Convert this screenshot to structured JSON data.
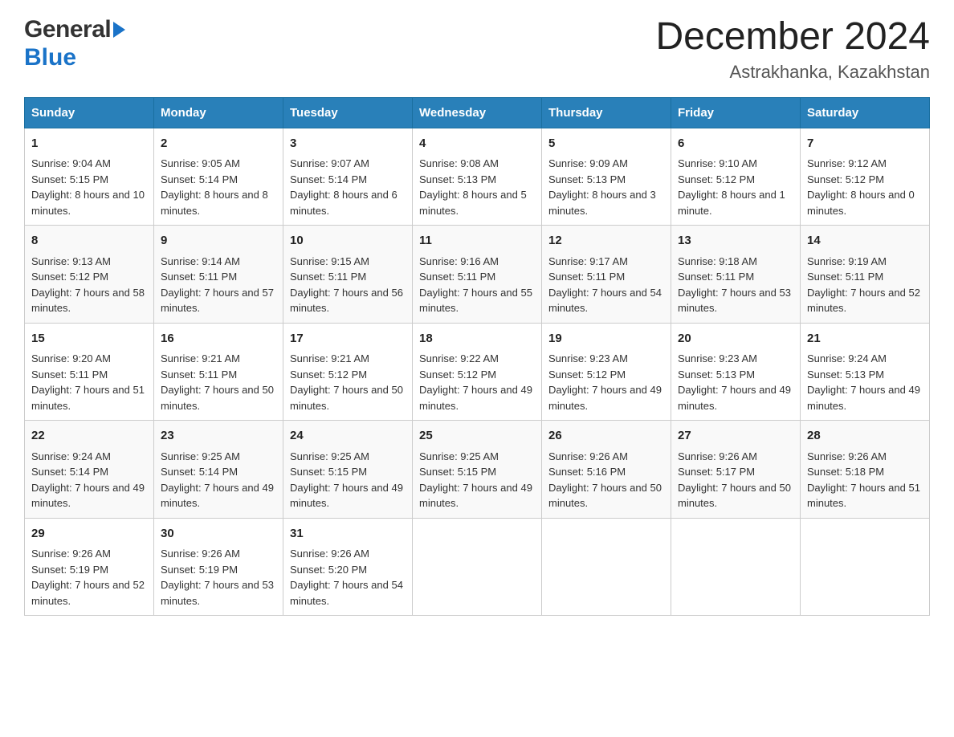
{
  "header": {
    "logo_general": "General",
    "logo_blue": "Blue",
    "title": "December 2024",
    "subtitle": "Astrakhanka, Kazakhstan"
  },
  "weekdays": [
    "Sunday",
    "Monday",
    "Tuesday",
    "Wednesday",
    "Thursday",
    "Friday",
    "Saturday"
  ],
  "weeks": [
    [
      {
        "day": "1",
        "sunrise": "Sunrise: 9:04 AM",
        "sunset": "Sunset: 5:15 PM",
        "daylight": "Daylight: 8 hours and 10 minutes."
      },
      {
        "day": "2",
        "sunrise": "Sunrise: 9:05 AM",
        "sunset": "Sunset: 5:14 PM",
        "daylight": "Daylight: 8 hours and 8 minutes."
      },
      {
        "day": "3",
        "sunrise": "Sunrise: 9:07 AM",
        "sunset": "Sunset: 5:14 PM",
        "daylight": "Daylight: 8 hours and 6 minutes."
      },
      {
        "day": "4",
        "sunrise": "Sunrise: 9:08 AM",
        "sunset": "Sunset: 5:13 PM",
        "daylight": "Daylight: 8 hours and 5 minutes."
      },
      {
        "day": "5",
        "sunrise": "Sunrise: 9:09 AM",
        "sunset": "Sunset: 5:13 PM",
        "daylight": "Daylight: 8 hours and 3 minutes."
      },
      {
        "day": "6",
        "sunrise": "Sunrise: 9:10 AM",
        "sunset": "Sunset: 5:12 PM",
        "daylight": "Daylight: 8 hours and 1 minute."
      },
      {
        "day": "7",
        "sunrise": "Sunrise: 9:12 AM",
        "sunset": "Sunset: 5:12 PM",
        "daylight": "Daylight: 8 hours and 0 minutes."
      }
    ],
    [
      {
        "day": "8",
        "sunrise": "Sunrise: 9:13 AM",
        "sunset": "Sunset: 5:12 PM",
        "daylight": "Daylight: 7 hours and 58 minutes."
      },
      {
        "day": "9",
        "sunrise": "Sunrise: 9:14 AM",
        "sunset": "Sunset: 5:11 PM",
        "daylight": "Daylight: 7 hours and 57 minutes."
      },
      {
        "day": "10",
        "sunrise": "Sunrise: 9:15 AM",
        "sunset": "Sunset: 5:11 PM",
        "daylight": "Daylight: 7 hours and 56 minutes."
      },
      {
        "day": "11",
        "sunrise": "Sunrise: 9:16 AM",
        "sunset": "Sunset: 5:11 PM",
        "daylight": "Daylight: 7 hours and 55 minutes."
      },
      {
        "day": "12",
        "sunrise": "Sunrise: 9:17 AM",
        "sunset": "Sunset: 5:11 PM",
        "daylight": "Daylight: 7 hours and 54 minutes."
      },
      {
        "day": "13",
        "sunrise": "Sunrise: 9:18 AM",
        "sunset": "Sunset: 5:11 PM",
        "daylight": "Daylight: 7 hours and 53 minutes."
      },
      {
        "day": "14",
        "sunrise": "Sunrise: 9:19 AM",
        "sunset": "Sunset: 5:11 PM",
        "daylight": "Daylight: 7 hours and 52 minutes."
      }
    ],
    [
      {
        "day": "15",
        "sunrise": "Sunrise: 9:20 AM",
        "sunset": "Sunset: 5:11 PM",
        "daylight": "Daylight: 7 hours and 51 minutes."
      },
      {
        "day": "16",
        "sunrise": "Sunrise: 9:21 AM",
        "sunset": "Sunset: 5:11 PM",
        "daylight": "Daylight: 7 hours and 50 minutes."
      },
      {
        "day": "17",
        "sunrise": "Sunrise: 9:21 AM",
        "sunset": "Sunset: 5:12 PM",
        "daylight": "Daylight: 7 hours and 50 minutes."
      },
      {
        "day": "18",
        "sunrise": "Sunrise: 9:22 AM",
        "sunset": "Sunset: 5:12 PM",
        "daylight": "Daylight: 7 hours and 49 minutes."
      },
      {
        "day": "19",
        "sunrise": "Sunrise: 9:23 AM",
        "sunset": "Sunset: 5:12 PM",
        "daylight": "Daylight: 7 hours and 49 minutes."
      },
      {
        "day": "20",
        "sunrise": "Sunrise: 9:23 AM",
        "sunset": "Sunset: 5:13 PM",
        "daylight": "Daylight: 7 hours and 49 minutes."
      },
      {
        "day": "21",
        "sunrise": "Sunrise: 9:24 AM",
        "sunset": "Sunset: 5:13 PM",
        "daylight": "Daylight: 7 hours and 49 minutes."
      }
    ],
    [
      {
        "day": "22",
        "sunrise": "Sunrise: 9:24 AM",
        "sunset": "Sunset: 5:14 PM",
        "daylight": "Daylight: 7 hours and 49 minutes."
      },
      {
        "day": "23",
        "sunrise": "Sunrise: 9:25 AM",
        "sunset": "Sunset: 5:14 PM",
        "daylight": "Daylight: 7 hours and 49 minutes."
      },
      {
        "day": "24",
        "sunrise": "Sunrise: 9:25 AM",
        "sunset": "Sunset: 5:15 PM",
        "daylight": "Daylight: 7 hours and 49 minutes."
      },
      {
        "day": "25",
        "sunrise": "Sunrise: 9:25 AM",
        "sunset": "Sunset: 5:15 PM",
        "daylight": "Daylight: 7 hours and 49 minutes."
      },
      {
        "day": "26",
        "sunrise": "Sunrise: 9:26 AM",
        "sunset": "Sunset: 5:16 PM",
        "daylight": "Daylight: 7 hours and 50 minutes."
      },
      {
        "day": "27",
        "sunrise": "Sunrise: 9:26 AM",
        "sunset": "Sunset: 5:17 PM",
        "daylight": "Daylight: 7 hours and 50 minutes."
      },
      {
        "day": "28",
        "sunrise": "Sunrise: 9:26 AM",
        "sunset": "Sunset: 5:18 PM",
        "daylight": "Daylight: 7 hours and 51 minutes."
      }
    ],
    [
      {
        "day": "29",
        "sunrise": "Sunrise: 9:26 AM",
        "sunset": "Sunset: 5:19 PM",
        "daylight": "Daylight: 7 hours and 52 minutes."
      },
      {
        "day": "30",
        "sunrise": "Sunrise: 9:26 AM",
        "sunset": "Sunset: 5:19 PM",
        "daylight": "Daylight: 7 hours and 53 minutes."
      },
      {
        "day": "31",
        "sunrise": "Sunrise: 9:26 AM",
        "sunset": "Sunset: 5:20 PM",
        "daylight": "Daylight: 7 hours and 54 minutes."
      },
      {
        "day": "",
        "sunrise": "",
        "sunset": "",
        "daylight": ""
      },
      {
        "day": "",
        "sunrise": "",
        "sunset": "",
        "daylight": ""
      },
      {
        "day": "",
        "sunrise": "",
        "sunset": "",
        "daylight": ""
      },
      {
        "day": "",
        "sunrise": "",
        "sunset": "",
        "daylight": ""
      }
    ]
  ]
}
